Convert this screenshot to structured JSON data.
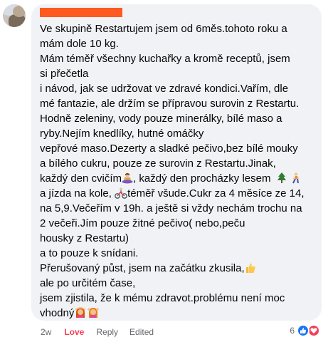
{
  "comment": {
    "author_redacted": true,
    "lines": [
      "Ve skupině Restartujem jsem od 6měs.tohoto roku a",
      "mám dole 10 kg.",
      "Mám téměř všechny kuchařky a kromě receptů, jsem",
      "si přečetla",
      "i návod, jak se udržovat ve zdravé kondici.Vařím, dle",
      "mé fantazie, ale držím se přípravou surovin z Restartu.",
      "Hodně zeleniny, vody pouze minerálky, bílé maso a",
      "ryby.Nejím knedlíky, hutné omáčky",
      "vepřové maso.Dezerty a sladké pečivo,bez bílé mouky",
      "a bílého cukru, pouze ze surovin z Restartu.Jinak,",
      "každý den cvičím",
      ", každý den procházky lesem",
      "a jízda na kole,",
      "téměř všude.Cukr za 4 měsíce ze 14,",
      "na 5,9.Večeřím v 19h. a ještě si vždy nechám trochu na",
      "2 večeři.Jím pouze žitné pečivo( nebo,peču",
      "housky z Restartu)",
      "a to pouze k snídani.",
      "Přerušovaný půst, jsem na začátku zkusila,",
      "ale po určitém čase,",
      "jsem zjistila, že k mému zdravot.problému není moc",
      "vhodný"
    ]
  },
  "emoji": {
    "exercise": "person-lotus-position-icon",
    "tree": "evergreen-tree-icon",
    "walk": "person-walking-icon",
    "bike": "person-biking-icon",
    "thumb": "thumbs-up-icon",
    "end1": "person-gesturing-ok-icon",
    "end2": "person-gesturing-ok-icon"
  },
  "actions": {
    "time": "2w",
    "love": "Love",
    "reply": "Reply",
    "edited": "Edited"
  },
  "reactions": {
    "count": "6",
    "types": [
      "like",
      "love"
    ],
    "colors": {
      "like": "#1877f2",
      "love": "#f33e58",
      "love_text": "#f33e58",
      "bubble": "#f0f2f5",
      "redaction": "#ff5a1f"
    }
  }
}
